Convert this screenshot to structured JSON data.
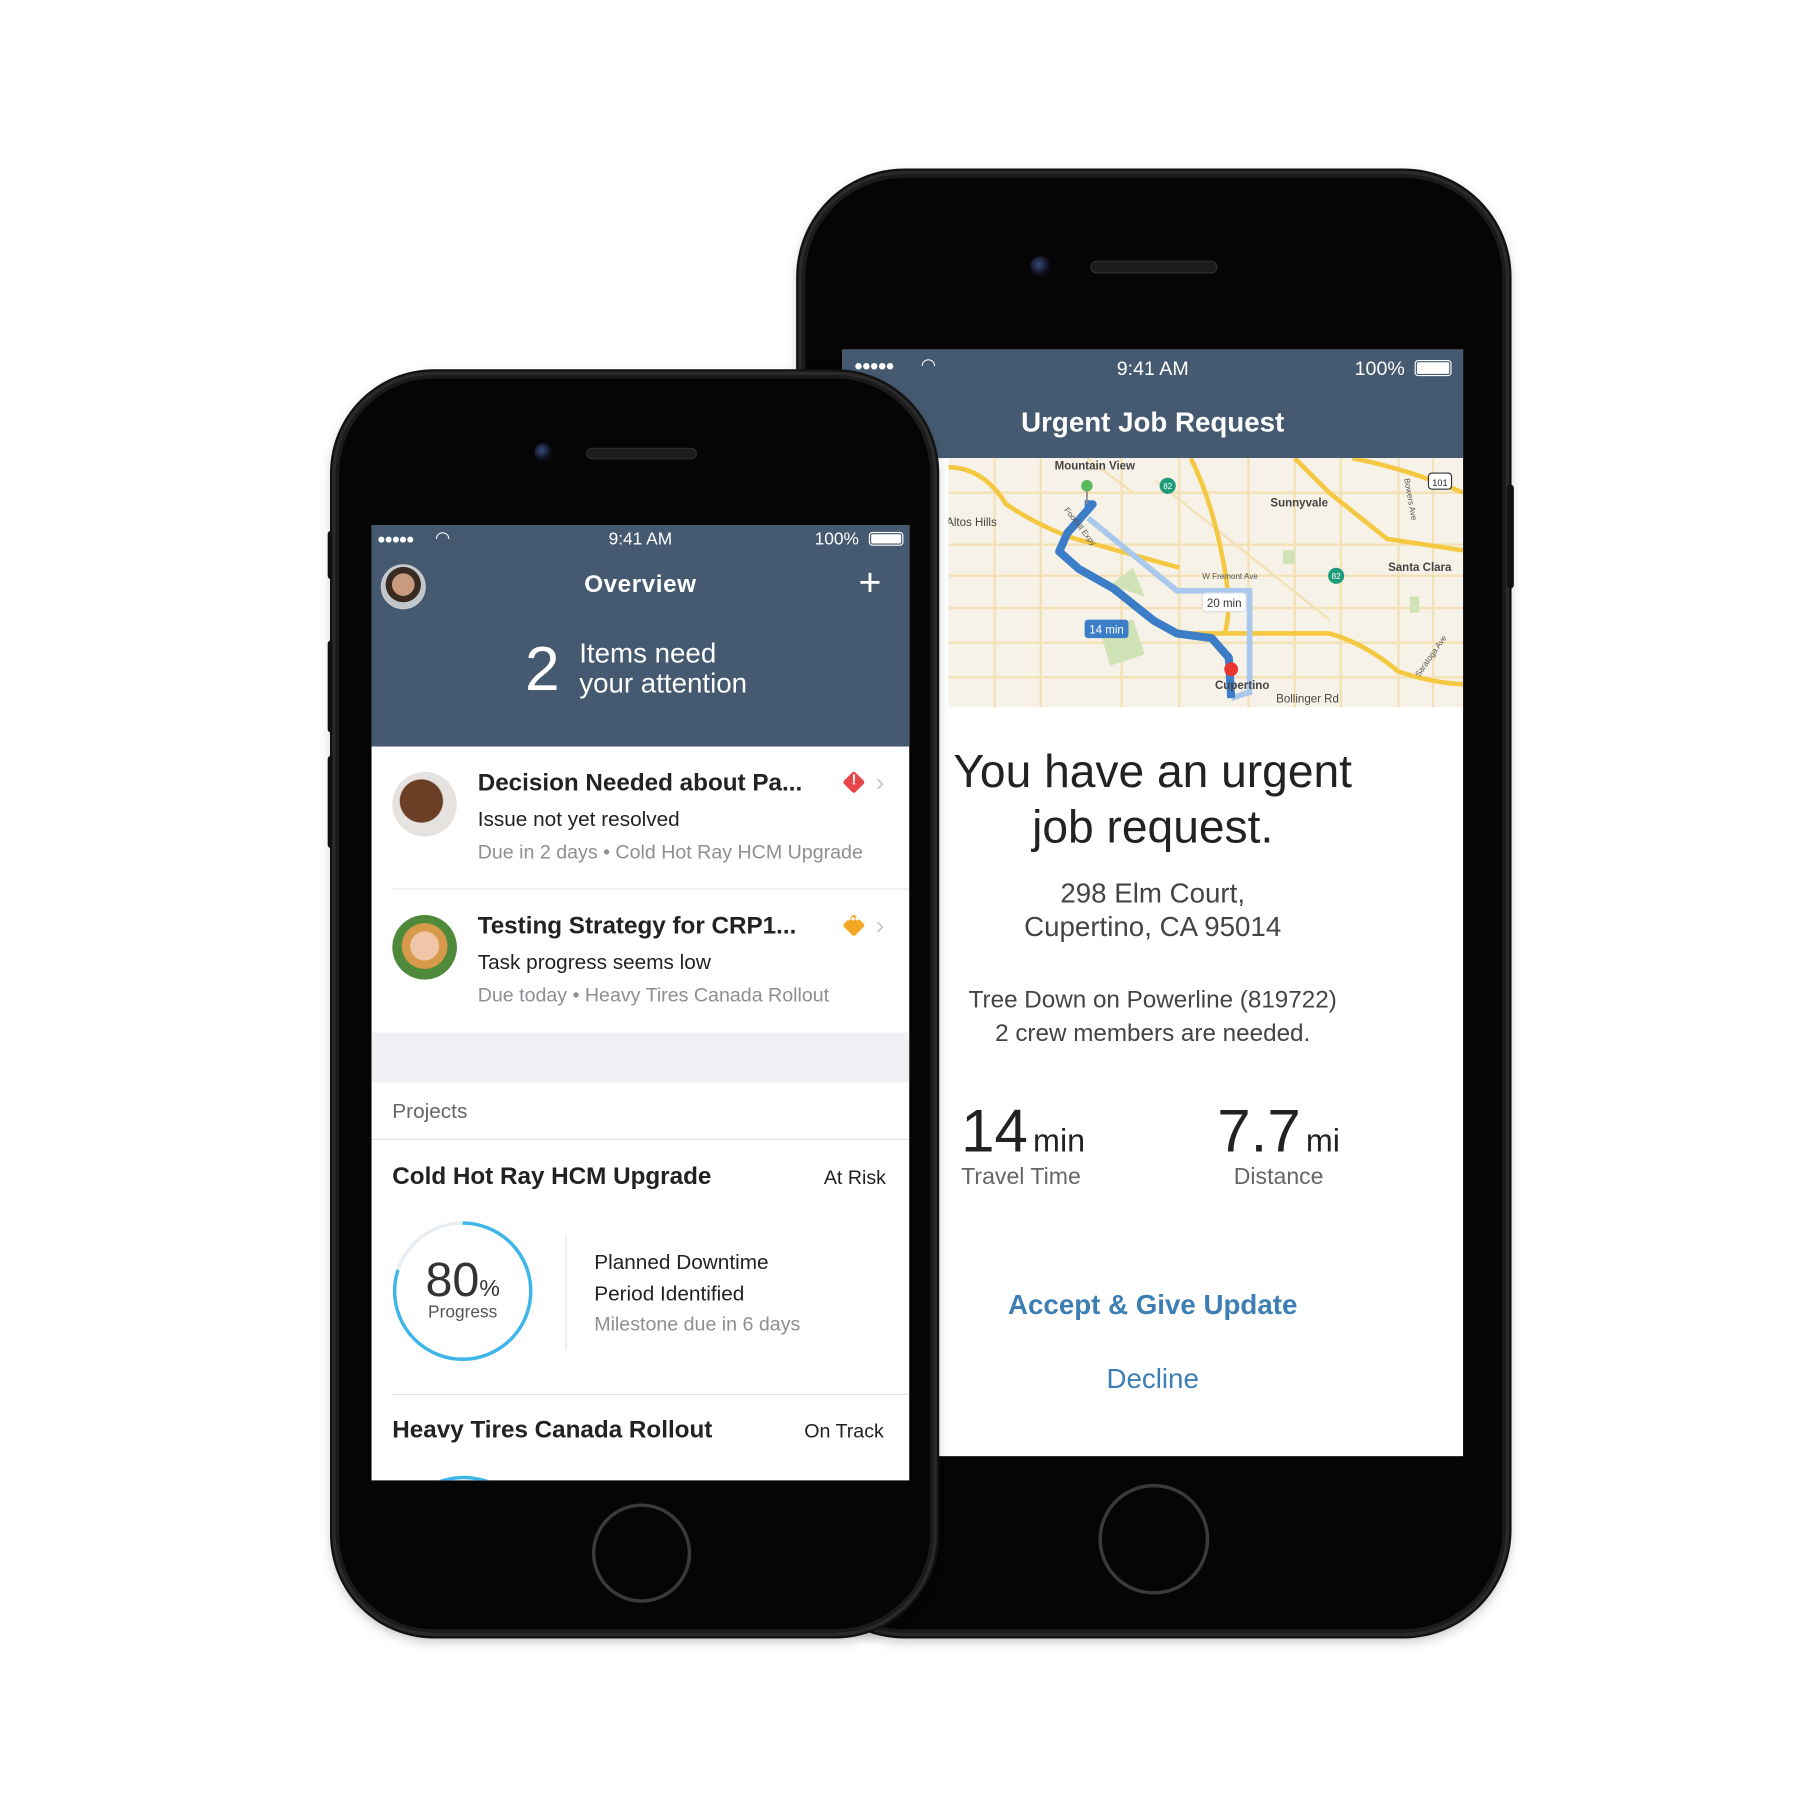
{
  "right_phone": {
    "status": {
      "time": "9:41 AM",
      "battery": "100%",
      "battery_level": 1.0
    },
    "header_title": "Urgent Job Request",
    "map": {
      "labels": {
        "mountain_view": "Mountain View",
        "sunnyvale": "Sunnyvale",
        "altos_hills": "Altos Hills",
        "santa_clara": "Santa Clara",
        "cupertino": "Cupertino",
        "fremont": "W Fremont Ave",
        "foothill": "Foothill Expy",
        "bowers": "Bowers Ave",
        "saratoga": "Saratoga Ave",
        "bollinger": "Bollinger Rd"
      },
      "route_fast": "14 min",
      "route_alt": "20 min",
      "shield_82": "82",
      "shield_101": "101",
      "colors": {
        "route": "#3c7dc8",
        "route_alt": "#a9c8ec",
        "highway": "#f5c842",
        "land": "#f7f2e7"
      }
    },
    "headline_1": "You have an urgent",
    "headline_2": "job request.",
    "address_1": "298 Elm Court,",
    "address_2": "Cupertino, CA 95014",
    "job_1": "Tree Down on Powerline (819722)",
    "job_2": "2 crew members are needed.",
    "travel": {
      "value": "14",
      "unit": "min",
      "label": "Travel Time"
    },
    "distance": {
      "value": "7.7",
      "unit": "mi",
      "label": "Distance"
    },
    "accept_label": "Accept & Give Update",
    "decline_label": "Decline",
    "accent": "#3d7fb5"
  },
  "left_phone": {
    "status": {
      "time": "9:41 AM",
      "battery": "100%",
      "battery_level": 1.0
    },
    "header_title": "Overview",
    "attention": {
      "count": "2",
      "line1": "Items need",
      "line2": "your attention"
    },
    "items": [
      {
        "title": "Decision Needed about Pa...",
        "subtitle": "Issue not yet resolved",
        "meta": "Due in 2 days • Cold Hot Ray HCM Upgrade",
        "icon": "alert-diamond-red"
      },
      {
        "title": "Testing Strategy for CRP1...",
        "subtitle": "Task progress seems low",
        "meta": "Due today • Heavy Tires Canada Rollout",
        "icon": "pending-diamond-orange"
      }
    ],
    "projects_label": "Projects",
    "projects": [
      {
        "name": "Cold Hot Ray HCM Upgrade",
        "status": "At Risk",
        "progress_value": "80",
        "progress_unit": "%",
        "progress_label": "Progress",
        "progress": 0.8,
        "milestone_1": "Planned Downtime",
        "milestone_2": "Period Identified",
        "milestone_due": "Milestone due in 6 days"
      },
      {
        "name": "Heavy Tires Canada Rollout",
        "status": "On Track"
      }
    ],
    "colors": {
      "header": "#455a70",
      "ring": "#3fb6ea",
      "alert": "#e8454b",
      "warning": "#f5a623"
    }
  }
}
